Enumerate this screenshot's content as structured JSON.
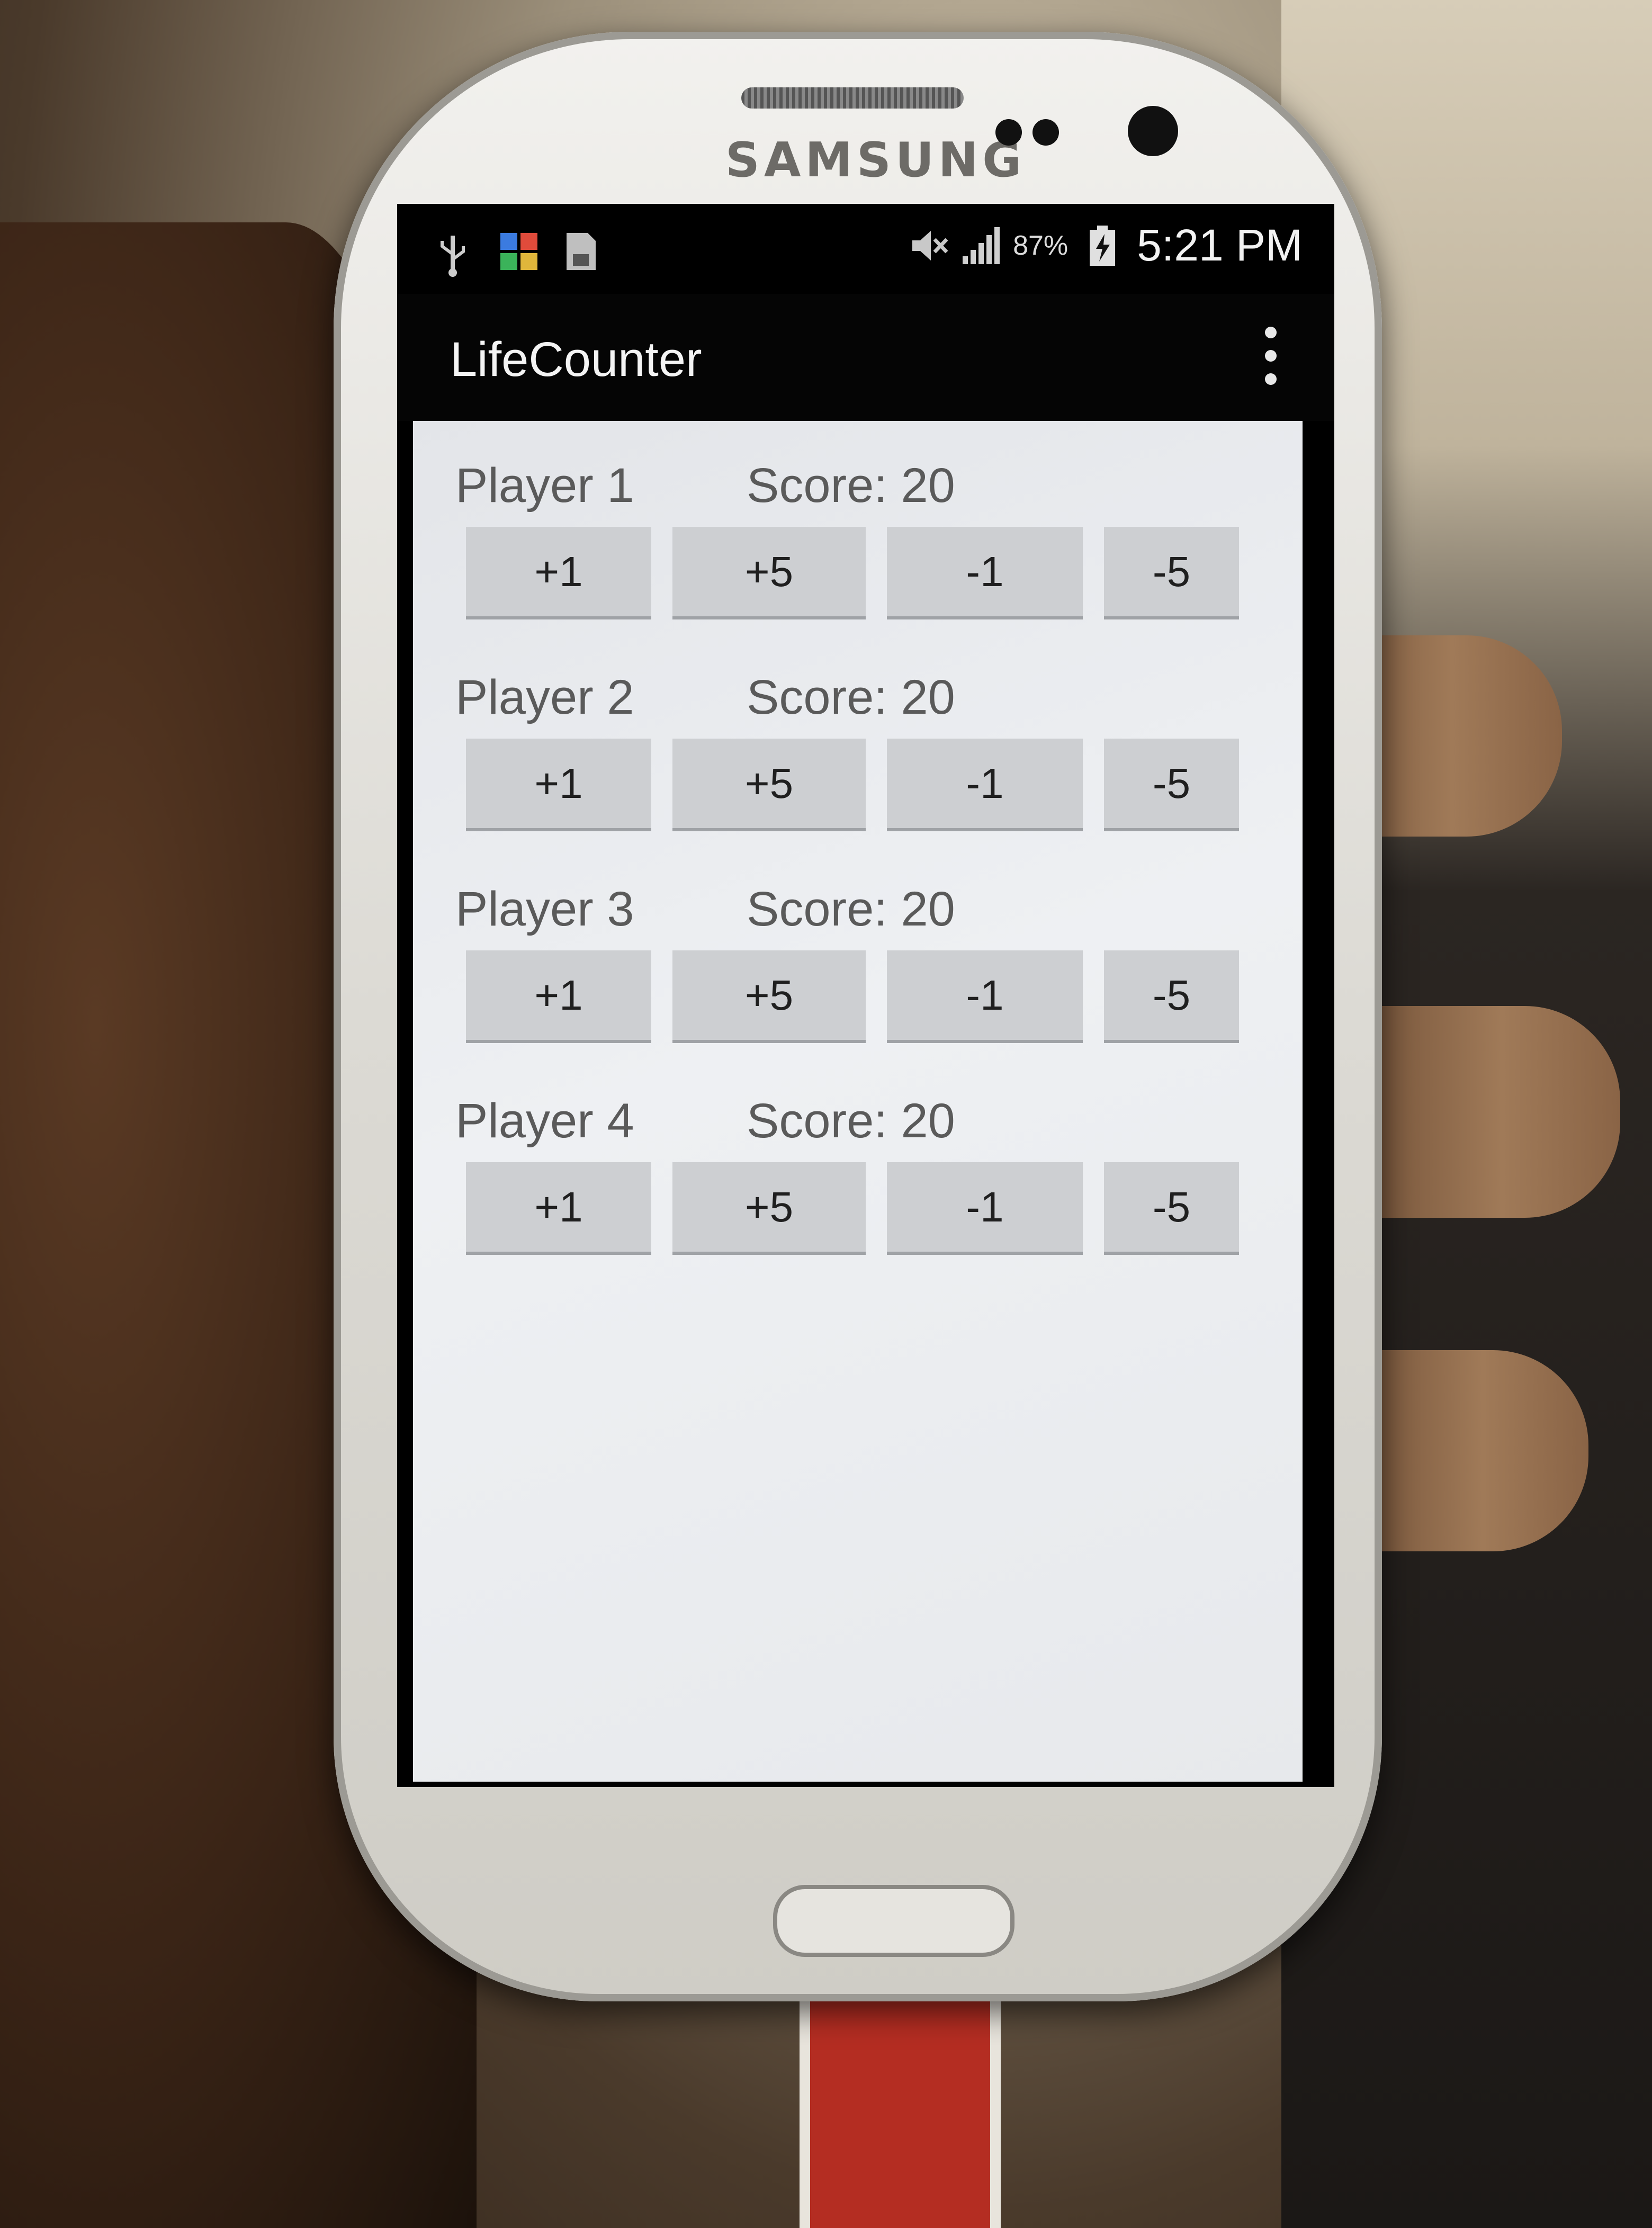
{
  "device": {
    "brand": "SAMSUNG"
  },
  "status_bar": {
    "left_icons": [
      "usb-icon",
      "photos-notification-icon",
      "sd-card-icon"
    ],
    "right_icons": [
      "mute-icon",
      "signal-icon",
      "battery-charging-icon"
    ],
    "battery_percent": "87%",
    "time": "5:21 PM"
  },
  "app": {
    "title": "LifeCounter",
    "menu_icon": "overflow-menu-icon"
  },
  "players": [
    {
      "name": "Player 1",
      "score": "Score: 20",
      "buttons": [
        "+1",
        "+5",
        "-1",
        "-5"
      ]
    },
    {
      "name": "Player 2",
      "score": "Score: 20",
      "buttons": [
        "+1",
        "+5",
        "-1",
        "-5"
      ]
    },
    {
      "name": "Player 3",
      "score": "Score: 20",
      "buttons": [
        "+1",
        "+5",
        "-1",
        "-5"
      ]
    },
    {
      "name": "Player 4",
      "score": "Score: 20",
      "buttons": [
        "+1",
        "+5",
        "-1",
        "-5"
      ]
    }
  ]
}
